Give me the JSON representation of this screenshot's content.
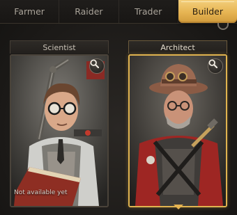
{
  "tabs": [
    {
      "label": "Farmer",
      "active": false
    },
    {
      "label": "Raider",
      "active": false
    },
    {
      "label": "Trader",
      "active": false
    },
    {
      "label": "Builder",
      "active": true
    }
  ],
  "cards": [
    {
      "title": "Scientist",
      "status": "Not available yet",
      "selected": false
    },
    {
      "title": "Architect",
      "status": "",
      "selected": true
    }
  ],
  "icons": {
    "zoom": "magnifier-icon",
    "corner": "round-toggle-icon"
  },
  "colors": {
    "accent_gold": "#e6b452",
    "selected_border": "#e0b34f",
    "background": "#1b1917"
  }
}
